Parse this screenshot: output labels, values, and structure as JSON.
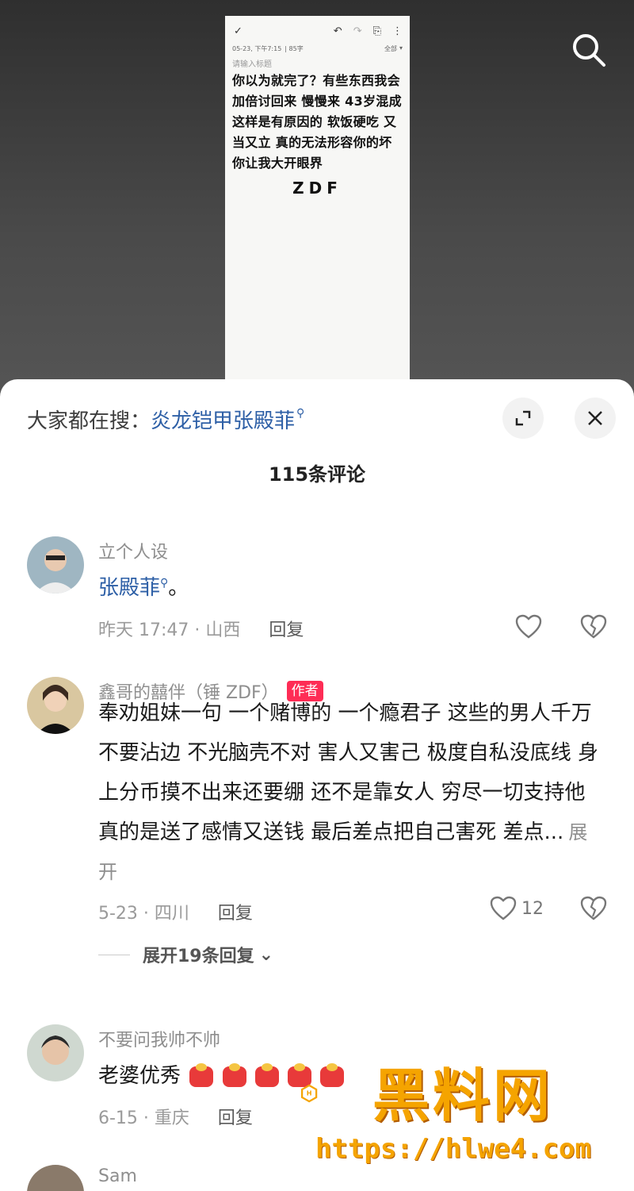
{
  "note": {
    "toolbar": {
      "check": "✓",
      "undo": "↶",
      "redo": "↷",
      "share": "⎘",
      "menu": "⋮"
    },
    "date": "05-23, 下午7:15",
    "word_count": "| 85字",
    "folder": "全部",
    "title_placeholder": "请输入标题",
    "body": "你以为就完了？有些东西我会加倍讨回来 慢慢来 43岁混成这样是有原因的 软饭硬吃 又当又立 真的无法形容你的坏 你让我大开眼界",
    "signature": "ZDF"
  },
  "top": {
    "search_icon": "search-icon"
  },
  "sheet": {
    "hot_search_prefix": "大家都在搜：",
    "hot_search_link": "炎龙铠甲张殿菲",
    "comment_count_title": "115条评论"
  },
  "comments": [
    {
      "user": "立个人设",
      "text_link": "张殿菲",
      "text_suffix": "。",
      "time_location": "昨天 17:47 · 山西",
      "reply": "回复",
      "likes": ""
    },
    {
      "user": "鑫哥的囍伴（锤 ZDF）",
      "badge": "作者",
      "text": "奉劝姐妹一句 一个赌博的 一个瘾君子 这些的男人千万不要沾边 不光脑壳不对 害人又害己 极度自私没底线 身上分币摸不出来还要绷 还不是靠女人 穷尽一切支持他 真的是送了感情又送钱 最后差点把自己害死 差点...",
      "more": "展开",
      "time_location": "5-23 · 四川",
      "reply": "回复",
      "likes": "12",
      "expand_replies": "展开19条回复"
    },
    {
      "user": "不要问我帅不帅",
      "text": "老婆优秀",
      "time_location": "6-15 · 重庆",
      "reply": "回复"
    },
    {
      "user": "Sam"
    }
  ],
  "watermark": {
    "brand": "黑料网",
    "url": "https://hlwe4.com"
  },
  "colors": {
    "link": "#2d5fa6",
    "badge": "#fe2c55",
    "watermark": "#f5a400"
  }
}
